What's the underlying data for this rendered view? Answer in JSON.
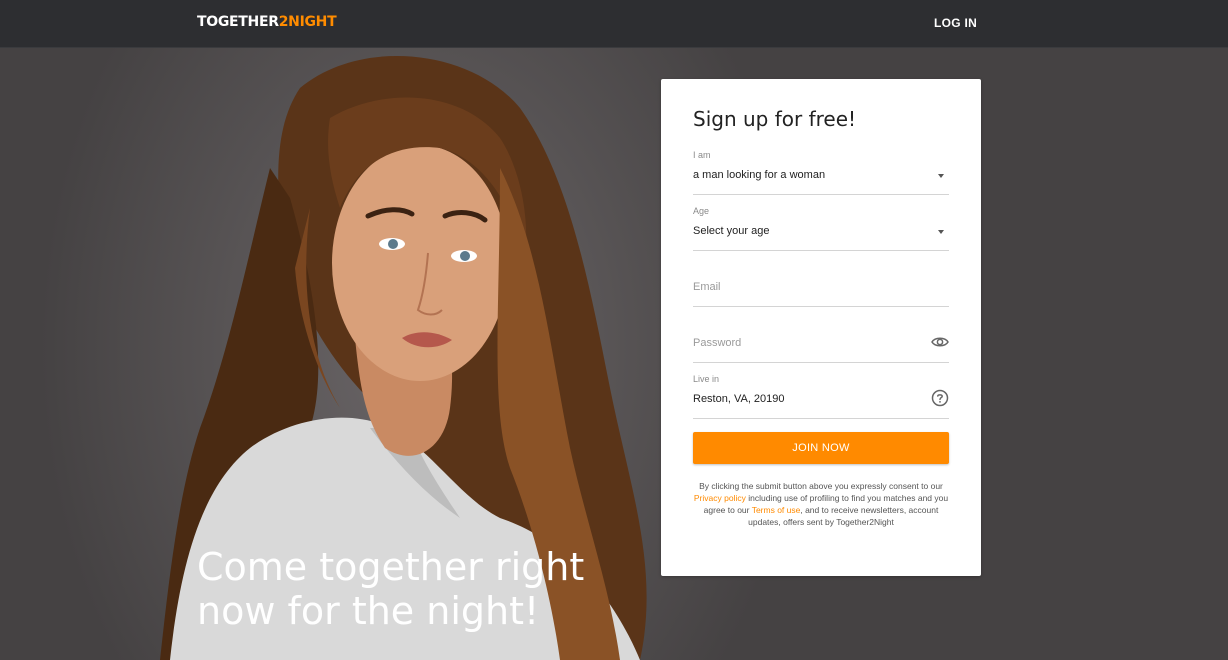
{
  "header": {
    "logo_main": "TOGETHER",
    "logo_accent": "2NIGHT",
    "login_label": "LOG IN"
  },
  "hero": {
    "headline": "Come together right now for the night!"
  },
  "signup": {
    "title": "Sign up for free!",
    "i_am": {
      "label": "I am",
      "value": "a man looking for a woman"
    },
    "age": {
      "label": "Age",
      "value": "Select your age"
    },
    "email": {
      "placeholder": "Email"
    },
    "password": {
      "placeholder": "Password"
    },
    "live_in": {
      "label": "Live in",
      "value": "Reston, VA, 20190"
    },
    "join_label": "JOIN NOW",
    "legal": {
      "part1": "By clicking the submit button above you expressly consent to our ",
      "privacy_link": "Privacy policy",
      "part2": " including use of profiling to find you matches and you agree to our ",
      "terms_link": "Terms of use",
      "part3": ", and to receive newsletters, account updates, offers sent by Together2Night"
    }
  },
  "colors": {
    "accent": "#ff8a00",
    "topbar": "#2d2e31",
    "background": "#4a4748"
  }
}
